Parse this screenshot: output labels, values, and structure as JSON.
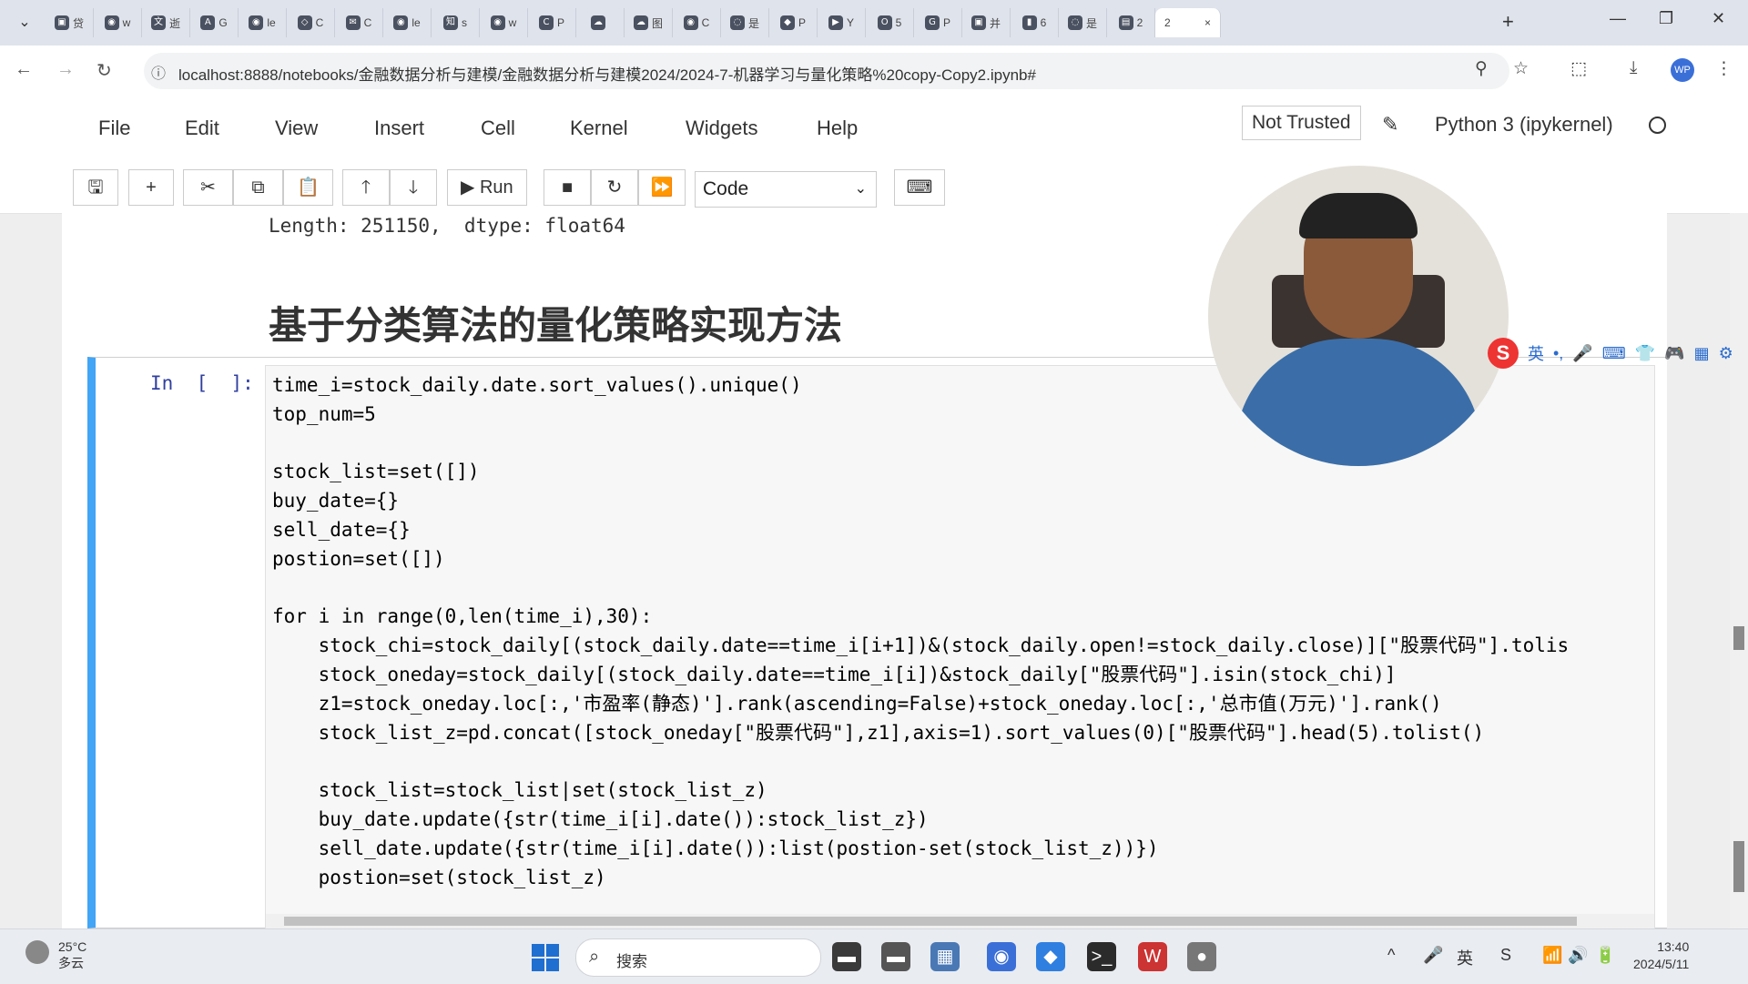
{
  "browser": {
    "tab_menu_icon": "chevron-down-icon",
    "tabs": [
      {
        "icon": "bilibili-icon",
        "glyph": "▣",
        "label": "贷"
      },
      {
        "icon": "github-icon",
        "glyph": "◉",
        "label": "w"
      },
      {
        "icon": "translate-icon",
        "glyph": "文",
        "label": "逝"
      },
      {
        "icon": "translate2-icon",
        "glyph": "A",
        "label": "G"
      },
      {
        "icon": "github-icon",
        "glyph": "◉",
        "label": "le"
      },
      {
        "icon": "cube-icon",
        "glyph": "◇",
        "label": "C"
      },
      {
        "icon": "mail-icon",
        "glyph": "✉",
        "label": "C"
      },
      {
        "icon": "github-icon",
        "glyph": "◉",
        "label": "le"
      },
      {
        "icon": "zhihu-icon",
        "glyph": "知",
        "label": "s"
      },
      {
        "icon": "github-icon",
        "glyph": "◉",
        "label": "w"
      },
      {
        "icon": "c-icon",
        "glyph": "C",
        "label": "P"
      },
      {
        "icon": "cloud-icon",
        "glyph": "☁",
        "label": ""
      },
      {
        "icon": "cloud-icon",
        "glyph": "☁",
        "label": "图"
      },
      {
        "icon": "github-icon",
        "glyph": "◉",
        "label": "C"
      },
      {
        "icon": "loading-icon",
        "glyph": "◌",
        "label": "是"
      },
      {
        "icon": "graduation-icon",
        "glyph": "◆",
        "label": "P"
      },
      {
        "icon": "youtube-icon",
        "glyph": "▶",
        "label": "Y"
      },
      {
        "icon": "o-icon",
        "glyph": "O",
        "label": "5"
      },
      {
        "icon": "google-icon",
        "glyph": "G",
        "label": "P"
      },
      {
        "icon": "bilibili-icon",
        "glyph": "▣",
        "label": "并"
      },
      {
        "icon": "chart-icon",
        "glyph": "▮",
        "label": "6"
      },
      {
        "icon": "loading-icon",
        "glyph": "◌",
        "label": "是"
      },
      {
        "icon": "doc-icon",
        "glyph": "▤",
        "label": "2"
      }
    ],
    "active_tab": {
      "label": "2",
      "close": "×"
    },
    "new_tab": "+",
    "window_controls": {
      "minimize": "—",
      "restore": "❐",
      "close": "✕"
    },
    "nav": {
      "back": "←",
      "forward": "→",
      "reload": "↻"
    },
    "url": "localhost:8888/notebooks/金融数据分析与建模/金融数据分析与建模2024/2024-7-机器学习与量化策略%20copy-Copy2.ipynb#",
    "nav_right_icons": {
      "zoom": "⚲",
      "star": "☆",
      "extensions": "⬚",
      "download": "⤓",
      "menu": "⋮"
    },
    "avatar": "WP"
  },
  "jupyter": {
    "menu": [
      "File",
      "Edit",
      "View",
      "Insert",
      "Cell",
      "Kernel",
      "Widgets",
      "Help"
    ],
    "trusted": "Not Trusted",
    "kernel": "Python 3 (ipykernel)",
    "toolbar": {
      "save": "🖫",
      "add": "+",
      "cut": "✂",
      "copy": "⧉",
      "paste": "📋",
      "up": "🡑",
      "down": "🡓",
      "run_icon": "▶",
      "run": "Run",
      "stop": "■",
      "restart": "↻",
      "fastforward": "⏩",
      "cell_type": "Code",
      "keyboard": "⌨"
    }
  },
  "notebook": {
    "prev_output": "Length: 251150,  dtype: float64",
    "heading": "基于分类算法的量化策略实现方法",
    "prompt": "In  [  ]:",
    "code": "time_i=stock_daily.date.sort_values().unique()\ntop_num=5\n\nstock_list=set([])\nbuy_date={}\nsell_date={}\npostion=set([])\n\nfor i in range(0,len(time_i),30):\n    stock_chi=stock_daily[(stock_daily.date==time_i[i+1])&(stock_daily.open!=stock_daily.close)][\"股票代码\"].tolis\n    stock_oneday=stock_daily[(stock_daily.date==time_i[i])&stock_daily[\"股票代码\"].isin(stock_chi)]\n    z1=stock_oneday.loc[:,'市盈率(静态)'].rank(ascending=False)+stock_oneday.loc[:,'总市值(万元)'].rank()\n    stock_list_z=pd.concat([stock_oneday[\"股票代码\"],z1],axis=1).sort_values(0)[\"股票代码\"].head(5).tolist()\n\n    stock_list=stock_list|set(stock_list_z)\n    buy_date.update({str(time_i[i].date()):stock_list_z})\n    sell_date.update({str(time_i[i].date()):list(postion-set(stock_list_z))})\n    postion=set(stock_list_z)"
  },
  "ime": {
    "logo": "S",
    "items": [
      "英",
      "•,",
      "🎤",
      "⌨",
      "👕",
      "🎮",
      "▦",
      "⚙"
    ]
  },
  "taskbar": {
    "weather_temp": "25°C",
    "weather_desc": "多云",
    "search_label": "搜索",
    "apps": [
      {
        "name": "file-explorer-icon",
        "glyph": "▬",
        "color": "#3a3a3a"
      },
      {
        "name": "folder-icon",
        "glyph": "▬",
        "color": "#555555"
      },
      {
        "name": "photos-icon",
        "glyph": "▦",
        "color": "#4a78b5"
      },
      {
        "name": "chrome-icon",
        "glyph": "◉",
        "color": "#3b6fd8"
      },
      {
        "name": "app-blue-icon",
        "glyph": "◆",
        "color": "#2f7fe0"
      },
      {
        "name": "terminal-icon",
        "glyph": ">_",
        "color": "#2b2b2b"
      },
      {
        "name": "wps-icon",
        "glyph": "W",
        "color": "#c33"
      },
      {
        "name": "app-gray-icon",
        "glyph": "●",
        "color": "#777777"
      }
    ],
    "tray": [
      "^",
      "🎤",
      "英",
      "S",
      "📶",
      "🔊",
      "🔋"
    ],
    "time": "13:40",
    "date": "2024/5/11"
  }
}
